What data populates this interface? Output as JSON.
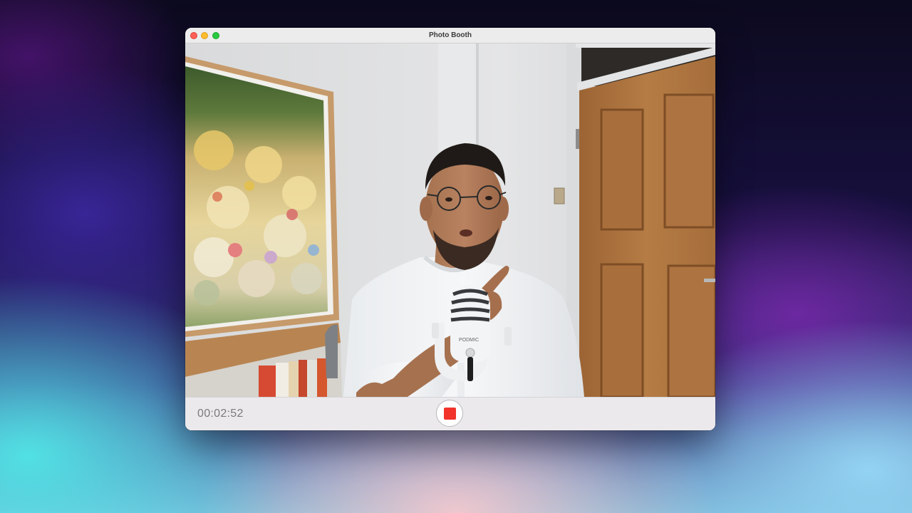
{
  "window": {
    "title": "Photo Booth"
  },
  "controls": {
    "recording_time": "00:02:52",
    "record_state": "recording",
    "record_button_icon": "stop-square-icon"
  },
  "colors": {
    "record_red": "#f1332b",
    "traffic_close": "#fe5f57",
    "traffic_minimize": "#febc2e",
    "traffic_zoom": "#28c840"
  }
}
